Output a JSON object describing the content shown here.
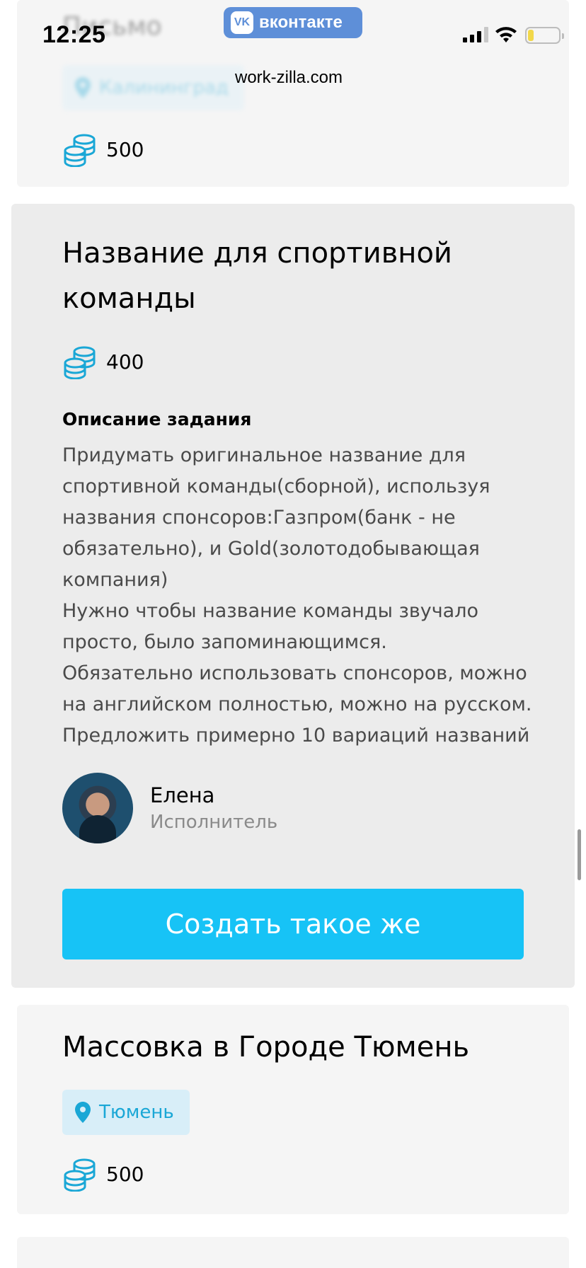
{
  "status_bar": {
    "time": "12:25",
    "battery_level": 0.2,
    "battery_color": "#f2d84a"
  },
  "app_pill": {
    "logo_text": "VK",
    "label": "вконтакте",
    "color": "#5e8fd8"
  },
  "site_url": "work-zilla.com",
  "colors": {
    "accent": "#17c3f6",
    "location_text": "#1aa7d6",
    "coin_icon": "#1aa7d6"
  },
  "cards": [
    {
      "title": "Письмо",
      "location": "Калининград",
      "price": "500"
    },
    {
      "title": "Название для спортивной команды",
      "price": "400",
      "description_heading": "Описание задания",
      "description": "Придумать оригинальное название для спортивной команды(сборной), используя названия спонсоров:Газпром(банк - не обязательно), и Gold(золотодобывающая компания)\nНужно чтобы название команды звучало просто, было запоминающимся.\nОбязательно использовать спонсоров, можно на английском полностью, можно на русском.\nПредложить примерно 10 вариаций названий",
      "user": {
        "name": "Елена",
        "role": "Исполнитель"
      },
      "button_label": "Создать такое же"
    },
    {
      "title": "Массовка в Городе Тюмень",
      "location": "Тюмень",
      "price": "500"
    }
  ]
}
